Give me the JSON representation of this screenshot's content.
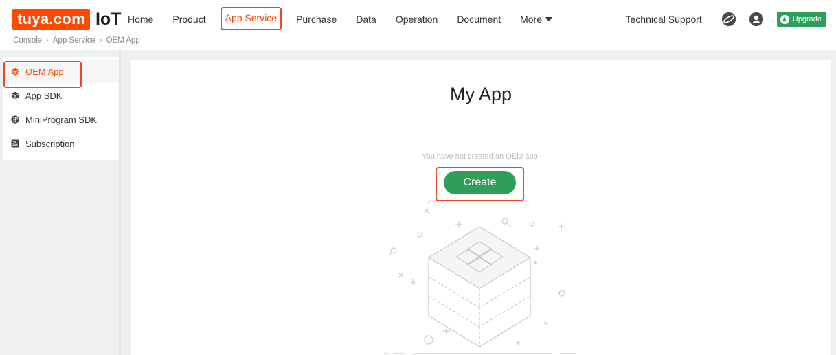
{
  "brand": {
    "logo_text": "tuya.com",
    "product": "IoT"
  },
  "nav": {
    "items": [
      {
        "label": "Home"
      },
      {
        "label": "Product"
      },
      {
        "label": "App Service",
        "active": true
      },
      {
        "label": "Purchase"
      },
      {
        "label": "Data"
      },
      {
        "label": "Operation"
      },
      {
        "label": "Document"
      },
      {
        "label": "More"
      }
    ]
  },
  "breadcrumb": [
    "Console",
    "App Service",
    "OEM App"
  ],
  "toolbar": {
    "tech_support": "Technical Support",
    "upgrade": "Upgrade"
  },
  "sidebar": {
    "items": [
      {
        "label": "OEM App",
        "icon": "layers-icon",
        "active": true
      },
      {
        "label": "App SDK",
        "icon": "cube-icon"
      },
      {
        "label": "MiniProgram SDK",
        "icon": "miniprogram-icon"
      },
      {
        "label": "Subscription",
        "icon": "rss-icon"
      }
    ]
  },
  "main": {
    "title": "My App",
    "empty_text": "You have not created an OEM app.",
    "create_label": "Create"
  },
  "colors": {
    "accent": "#ff4800",
    "primary_button": "#2f9e5b",
    "highlight": "#e8492a",
    "upgrade": "#2aa15a"
  }
}
